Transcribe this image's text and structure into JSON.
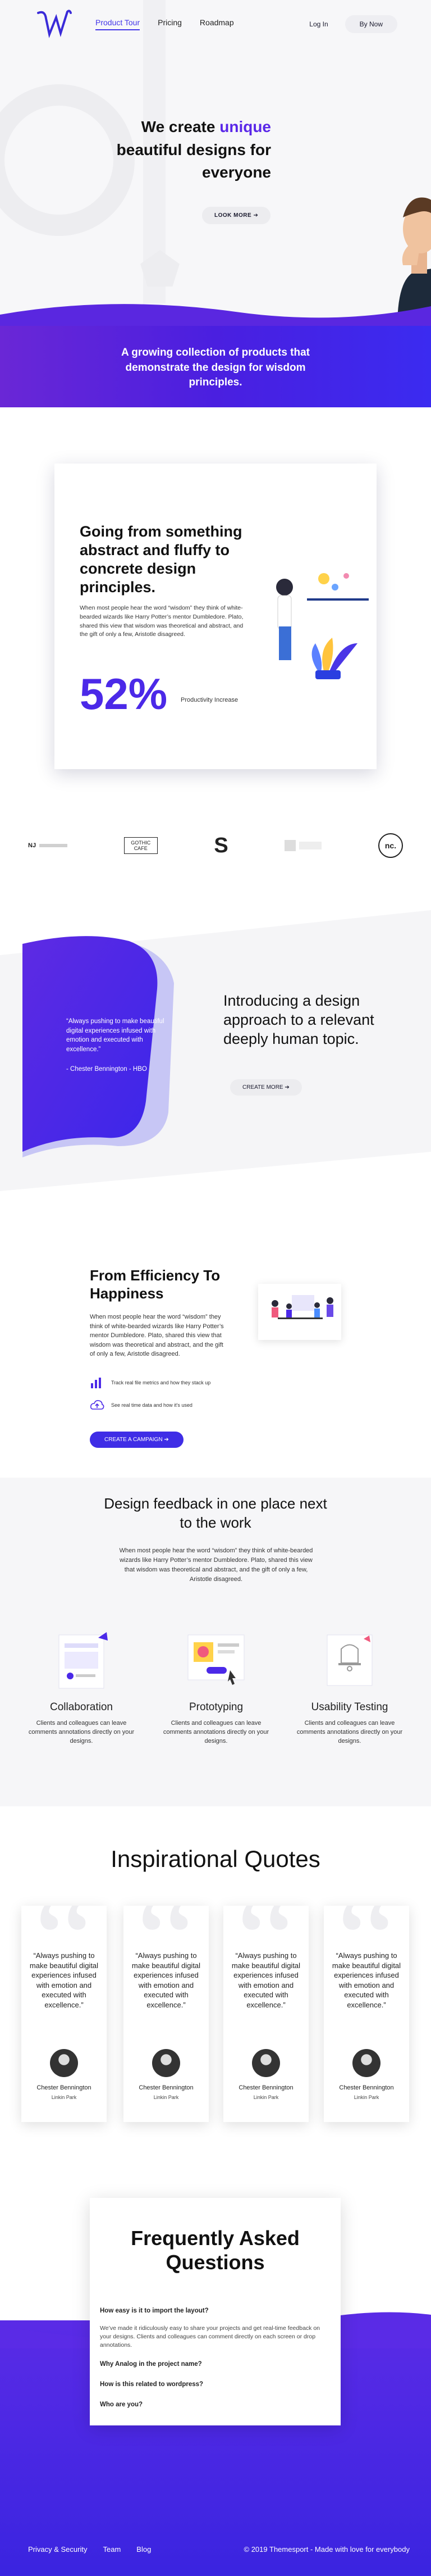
{
  "nav": {
    "links": [
      "Product Tour",
      "Pricing",
      "Roadmap"
    ],
    "login": "Log In",
    "buy": "By Now"
  },
  "hero": {
    "title_pre": "We create",
    "title_hl": "unique",
    "title_post": "beautiful designs for everyone",
    "button": "LOOK MORE ➔"
  },
  "banner": {
    "text": "A growing collection of products that demonstrate the design for wisdom principles."
  },
  "stat": {
    "title": "Going from something abstract and fluffy to concrete design principles.",
    "text": "When most people hear the word “wisdom” they think of white-bearded wizards like Harry Potter’s mentor Dumbledore. Plato, shared this view that wisdom was theoretical and abstract, and the gift of only a few, Aristotle disagreed.",
    "value": "52%",
    "label": "Productivity Increase"
  },
  "logos": [
    "NJ",
    "GOTHIC CAFE",
    "S",
    "",
    "nc."
  ],
  "intro": {
    "quote": "“Always pushing to make beautiful digital experiences infused with emotion and executed with excellence.”",
    "author": "- Chester Bennington - HBO",
    "title": "Introducing a design approach to a relevant deeply human topic.",
    "button": "CREATE MORE ➔"
  },
  "efficiency": {
    "title": "From Efficiency To Happiness",
    "text": "When most people hear the word “wisdom” they think of white-bearded wizards like Harry Potter’s mentor Dumbledore. Plato, shared this view that wisdom was theoretical and abstract, and the gift of only a few, Aristotle disagreed.",
    "feature1": "Track real file metrics and how they stack up",
    "feature2": "See real time data and how it’s used",
    "button": "CREATE A CAMPAIGN ➔"
  },
  "feedback": {
    "title": "Design feedback in one place next to the work",
    "text": "When most people hear the word “wisdom” they think of white-bearded wizards like Harry Potter’s mentor Dumbledore. Plato, shared this view that wisdom was theoretical and abstract, and the gift of only a few, Aristotle disagreed.",
    "features": [
      {
        "title": "Collaboration",
        "text": "Clients and colleagues can leave comments annotations directly on your designs."
      },
      {
        "title": "Prototyping",
        "text": "Clients and colleagues can leave comments annotations directly on your designs."
      },
      {
        "title": "Usability Testing",
        "text": "Clients and colleagues can leave comments annotations directly on your designs."
      }
    ]
  },
  "quotes": {
    "title": "Inspirational Quotes",
    "items": [
      {
        "text": "“Always pushing to make beautiful digital experiences infused with emotion and executed with excellence.”",
        "name": "Chester Bennington",
        "company": "Linkin Park"
      },
      {
        "text": "“Always pushing to make beautiful digital experiences infused with emotion and executed with excellence.”",
        "name": "Chester Bennington",
        "company": "Linkin Park"
      },
      {
        "text": "“Always pushing to make beautiful digital experiences infused with emotion and executed with excellence.”",
        "name": "Chester Bennington",
        "company": "Linkin Park"
      },
      {
        "text": "“Always pushing to make beautiful digital experiences infused with emotion and executed with excellence.”",
        "name": "Chester Bennington",
        "company": "Linkin Park"
      }
    ]
  },
  "faq": {
    "title": "Frequently Asked Questions",
    "q1": "How easy is it to import the layout?",
    "a1": "We’ve made it ridiculously easy to share your projects and get real-time feedback on your designs. Clients and colleagues can comment directly on each screen or drop annotations.",
    "q2": "Why Analog in the project name?",
    "q3": "How is this related to wordpress?",
    "q4": "Who are you?"
  },
  "footer": {
    "links": [
      "Privacy & Security",
      "Team",
      "Blog"
    ],
    "copy": "© 2019 Themesport - Made with love for everybody"
  },
  "colors": {
    "accent": "#4b29e8",
    "gradient_start": "#6a27d6",
    "gradient_end": "#3b2bf0"
  }
}
